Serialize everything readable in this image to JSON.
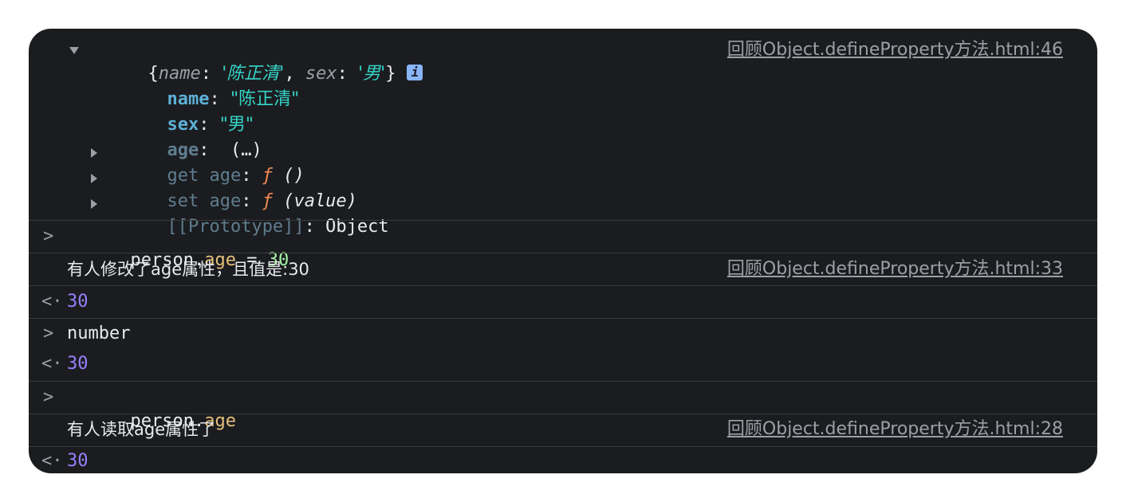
{
  "object_entry": {
    "preview_open": "{",
    "preview_name_key": "name",
    "preview_name_val": "'陈正清'",
    "preview_sex_key": "sex",
    "preview_sex_val": "'男'",
    "preview_close": "}",
    "info_badge": "i",
    "source": "回顾Object.defineProperty方法.html:46",
    "props": [
      {
        "key": "name",
        "value": "\"陈正清\""
      },
      {
        "key": "sex",
        "value": "\"男\""
      },
      {
        "key": "age",
        "value": "(…)"
      }
    ],
    "getter_key": "get age",
    "getter_f": "ƒ",
    "getter_sig": "()",
    "setter_key": "set age",
    "setter_f": "ƒ",
    "setter_sig": "(value)",
    "proto_key": "[[Prototype]]",
    "proto_val": "Object"
  },
  "entries": [
    {
      "type": "input",
      "obj": "person",
      "dot": ".",
      "prop": "age",
      "op": " = ",
      "num": "30"
    },
    {
      "type": "log",
      "text": "有人修改了age属性，且值是:30",
      "source": "回顾Object.defineProperty方法.html:33"
    },
    {
      "type": "result",
      "value": "30"
    },
    {
      "type": "input",
      "text": "number"
    },
    {
      "type": "result",
      "value": "30"
    },
    {
      "type": "input",
      "obj": "person",
      "dot": ".",
      "prop": "age"
    },
    {
      "type": "log",
      "text": "有人读取age属性了",
      "source": "回顾Object.defineProperty方法.html:28"
    },
    {
      "type": "result",
      "value": "30"
    }
  ],
  "icons": {
    "prompt": "chevron-right-icon",
    "result": "result-arrow-icon",
    "expand": "triangle-icon"
  },
  "colors": {
    "background": "#1b1c1f",
    "string": "#35d4c7",
    "number": "#9980ff",
    "property": "#5db0d7",
    "function": "#f28b54"
  }
}
